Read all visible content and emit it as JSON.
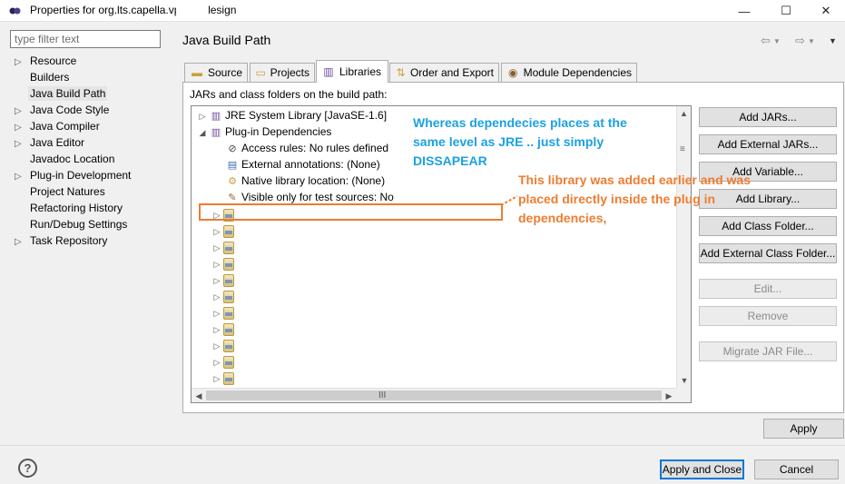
{
  "window": {
    "title": "Properties for org.lts.capella.vp        design",
    "minimize_label": "—",
    "maximize_label": "☐",
    "close_label": "✕"
  },
  "filter": {
    "placeholder": "type filter text"
  },
  "nav": {
    "items": [
      {
        "label": "Resource",
        "expandable": true
      },
      {
        "label": "Builders",
        "expandable": false
      },
      {
        "label": "Java Build Path",
        "expandable": false,
        "selected": true
      },
      {
        "label": "Java Code Style",
        "expandable": true
      },
      {
        "label": "Java Compiler",
        "expandable": true
      },
      {
        "label": "Java Editor",
        "expandable": true
      },
      {
        "label": "Javadoc Location",
        "expandable": false
      },
      {
        "label": "Plug-in Development",
        "expandable": true
      },
      {
        "label": "Project Natures",
        "expandable": false
      },
      {
        "label": "Refactoring History",
        "expandable": false
      },
      {
        "label": "Run/Debug Settings",
        "expandable": false
      },
      {
        "label": "Task Repository",
        "expandable": true
      }
    ]
  },
  "page": {
    "title": "Java Build Path"
  },
  "tabs": [
    {
      "label": "Source",
      "icon": "source-folder-icon"
    },
    {
      "label": "Projects",
      "icon": "projects-icon"
    },
    {
      "label": "Libraries",
      "icon": "libraries-icon",
      "active": true
    },
    {
      "label": "Order and Export",
      "icon": "order-export-icon"
    },
    {
      "label": "Module Dependencies",
      "icon": "module-dependencies-icon"
    }
  ],
  "libraries": {
    "caption": "JARs and class folders on the build path:",
    "tree": {
      "jre": "JRE System Library [JavaSE-1.6]",
      "plugin_deps": "Plug-in Dependencies",
      "children": [
        "Access rules: No rules defined",
        "External annotations: (None)",
        "Native library location: (None)",
        "Visible only for test sources: No"
      ],
      "collapsed_jar_count": 11
    },
    "buttons": {
      "add_jars": "Add JARs...",
      "add_external_jars": "Add External JARs...",
      "add_variable": "Add Variable...",
      "add_library": "Add Library...",
      "add_class_folder": "Add Class Folder...",
      "add_external_class_folder": "Add External Class Folder...",
      "edit": "Edit...",
      "remove": "Remove",
      "migrate": "Migrate JAR File..."
    },
    "hscroll_thumb": "III"
  },
  "footer": {
    "apply": "Apply",
    "apply_close": "Apply and Close",
    "cancel": "Cancel",
    "help": "?"
  },
  "annotations": {
    "blue_lines": [
      "Whereas dependecies places at the",
      "same level as JRE .. just simply",
      "DISSAPEAR"
    ],
    "orange_lines": [
      "This library was added earlier and was",
      "placed directly inside  the plug in",
      "dependencies,"
    ]
  },
  "colors": {
    "annotation_blue": "#1ba1e2",
    "annotation_orange": "#ed7d31",
    "default_button_border": "#0078d7"
  }
}
